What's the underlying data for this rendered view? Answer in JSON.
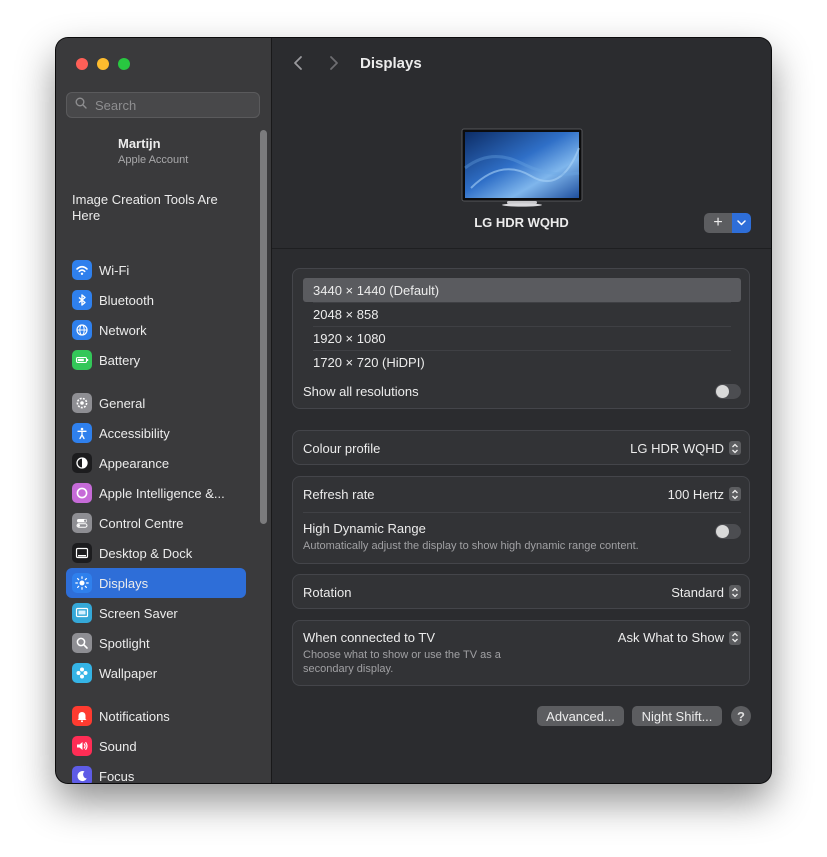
{
  "window": {
    "title": "Displays"
  },
  "search": {
    "placeholder": "Search"
  },
  "account": {
    "name": "Martijn",
    "subtitle": "Apple Account"
  },
  "promo": {
    "text": "Image Creation Tools Are Here"
  },
  "sidebar": {
    "items": [
      {
        "label": "Wi-Fi",
        "icon": "wifi-icon",
        "color": "#2f80ed"
      },
      {
        "label": "Bluetooth",
        "icon": "bluetooth-icon",
        "color": "#2f80ed"
      },
      {
        "label": "Network",
        "icon": "globe-icon",
        "color": "#2f80ed"
      },
      {
        "label": "Battery",
        "icon": "battery-icon",
        "color": "#33c759"
      },
      {
        "label": "General",
        "icon": "gear-icon",
        "color": "#8e8e93"
      },
      {
        "label": "Accessibility",
        "icon": "accessibility-icon",
        "color": "#2f80ed"
      },
      {
        "label": "Appearance",
        "icon": "appearance-icon",
        "color": "#1c1c1e"
      },
      {
        "label": "Apple Intelligence &...",
        "icon": "apple-intelligence-icon",
        "color": "#c66bd8"
      },
      {
        "label": "Control Centre",
        "icon": "control-centre-icon",
        "color": "#8e8e93"
      },
      {
        "label": "Desktop & Dock",
        "icon": "dock-icon",
        "color": "#1c1c1e"
      },
      {
        "label": "Displays",
        "icon": "sun-icon",
        "color": "#2f80ed"
      },
      {
        "label": "Screen Saver",
        "icon": "screen-saver-icon",
        "color": "#35a8d8"
      },
      {
        "label": "Spotlight",
        "icon": "spotlight-icon",
        "color": "#8e8e93"
      },
      {
        "label": "Wallpaper",
        "icon": "wallpaper-icon",
        "color": "#35b4e6"
      },
      {
        "label": "Notifications",
        "icon": "bell-icon",
        "color": "#ff3b30"
      },
      {
        "label": "Sound",
        "icon": "speaker-icon",
        "color": "#ff2d55"
      },
      {
        "label": "Focus",
        "icon": "moon-icon",
        "color": "#5e5ce6"
      }
    ],
    "selected_label": "Displays"
  },
  "display": {
    "name": "LG HDR WQHD"
  },
  "resolutions": {
    "options": [
      "3440 × 1440 (Default)",
      "2048 × 858",
      "1920 × 1080",
      "1720 × 720 (HiDPI)"
    ],
    "selected": "3440 × 1440 (Default)",
    "show_all_label": "Show all resolutions",
    "show_all_enabled": false
  },
  "colour_profile": {
    "label": "Colour profile",
    "value": "LG HDR WQHD"
  },
  "refresh": {
    "label": "Refresh rate",
    "value": "100 Hertz"
  },
  "hdr": {
    "label": "High Dynamic Range",
    "description": "Automatically adjust the display to show high dynamic range content.",
    "enabled": false
  },
  "rotation": {
    "label": "Rotation",
    "value": "Standard"
  },
  "tv": {
    "label": "When connected to TV",
    "description": "Choose what to show or use the TV as a secondary display.",
    "value": "Ask What to Show"
  },
  "buttons": {
    "advanced": "Advanced...",
    "night_shift": "Night Shift...",
    "help": "?"
  },
  "accent": "#2e6ed8"
}
